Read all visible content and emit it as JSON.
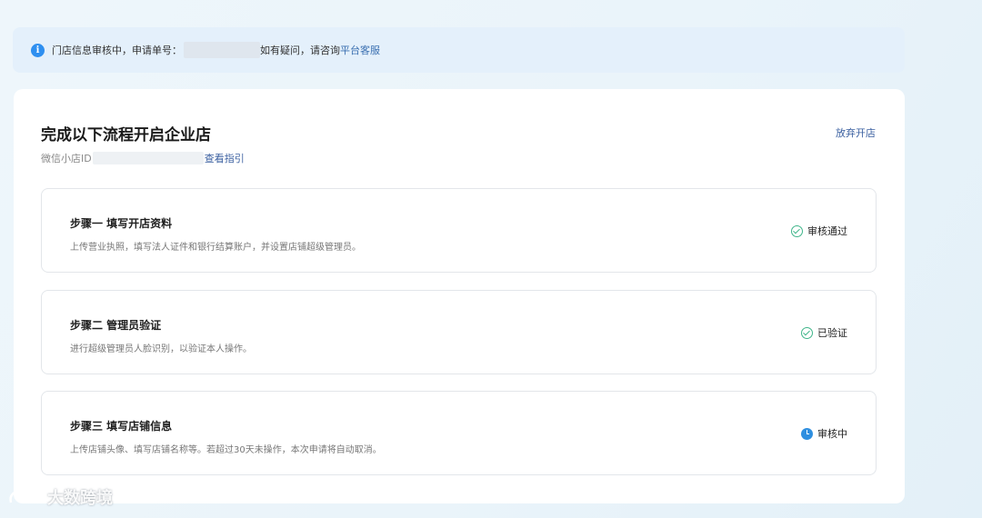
{
  "notice": {
    "prefix": "门店信息审核中，申请单号：",
    "suffix": "如有疑问，请咨询",
    "link": "平台客服"
  },
  "card": {
    "title": "完成以下流程开启企业店",
    "abandon_label": "放弃开店",
    "shop_id_label": "微信小店ID",
    "guide_label": "查看指引"
  },
  "steps": [
    {
      "title": "步骤一 填写开店资料",
      "desc": "上传营业执照，填写法人证件和银行结算账户，并设置店铺超级管理员。",
      "status": "审核通过",
      "status_icon": "check-circle-icon"
    },
    {
      "title": "步骤二 管理员验证",
      "desc": "进行超级管理员人脸识别，以验证本人操作。",
      "status": "已验证",
      "status_icon": "check-circle-icon"
    },
    {
      "title": "步骤三 填写店铺信息",
      "desc": "上传店铺头像、填写店铺名称等。若超过30天未操作，本次申请将自动取消。",
      "status": "审核中",
      "status_icon": "clock-icon"
    }
  ],
  "watermark": {
    "text": "大数跨境"
  },
  "colors": {
    "accent_link": "#3a5fa0",
    "info_blue": "#2e8ff0",
    "success_green": "#3fb58a",
    "pending_blue": "#2f8fe0"
  }
}
